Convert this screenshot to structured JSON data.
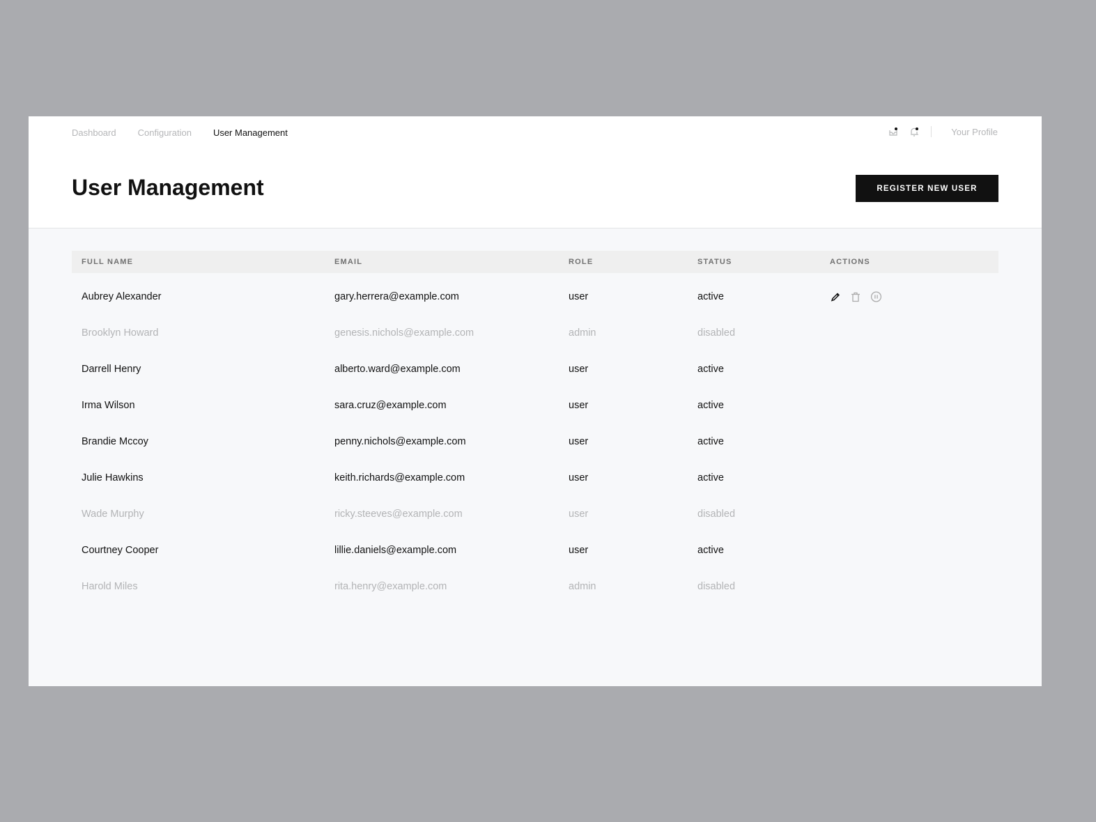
{
  "nav": {
    "items": [
      {
        "label": "Dashboard",
        "active": false
      },
      {
        "label": "Configuration",
        "active": false
      },
      {
        "label": "User Management",
        "active": true
      }
    ],
    "profile": "Your Profile"
  },
  "page": {
    "title": "User Management",
    "register_button": "REGISTER NEW USER"
  },
  "table": {
    "headers": [
      "FULL NAME",
      "EMAIL",
      "ROLE",
      "STATUS",
      "ACTIONS"
    ],
    "rows": [
      {
        "name": "Aubrey Alexander",
        "email": "gary.herrera@example.com",
        "role": "user",
        "status": "active"
      },
      {
        "name": "Brooklyn Howard",
        "email": "genesis.nichols@example.com",
        "role": "admin",
        "status": "disabled"
      },
      {
        "name": "Darrell Henry",
        "email": "alberto.ward@example.com",
        "role": "user",
        "status": "active"
      },
      {
        "name": "Irma Wilson",
        "email": "sara.cruz@example.com",
        "role": "user",
        "status": "active"
      },
      {
        "name": "Brandie Mccoy",
        "email": "penny.nichols@example.com",
        "role": "user",
        "status": "active"
      },
      {
        "name": "Julie Hawkins",
        "email": "keith.richards@example.com",
        "role": "user",
        "status": "active"
      },
      {
        "name": "Wade Murphy",
        "email": "ricky.steeves@example.com",
        "role": "user",
        "status": "disabled"
      },
      {
        "name": "Courtney Cooper",
        "email": "lillie.daniels@example.com",
        "role": "user",
        "status": "active"
      },
      {
        "name": "Harold Miles",
        "email": "rita.henry@example.com",
        "role": "admin",
        "status": "disabled"
      }
    ]
  }
}
